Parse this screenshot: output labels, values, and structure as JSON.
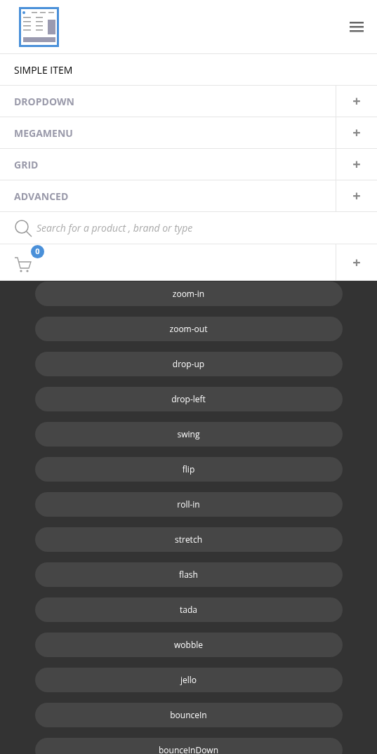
{
  "menu": [
    {
      "label": "SIMPLE ITEM",
      "kind": "simple"
    },
    {
      "label": "DROPDOWN",
      "kind": "expandable",
      "expander": "+"
    },
    {
      "label": "MEGAMENU",
      "kind": "expandable",
      "expander": "+"
    },
    {
      "label": "GRID",
      "kind": "expandable",
      "expander": "+"
    },
    {
      "label": "ADVANCED",
      "kind": "expandable",
      "expander": "+"
    }
  ],
  "search": {
    "placeholder": "Search for a product , brand or type"
  },
  "cart": {
    "count": "0",
    "expander": "+"
  },
  "effects": [
    "zoom-in",
    "zoom-out",
    "drop-up",
    "drop-left",
    "swing",
    "flip",
    "roll-in",
    "stretch",
    "flash",
    "tada",
    "wobble",
    "jello",
    "bounceIn",
    "bounceInDown"
  ]
}
